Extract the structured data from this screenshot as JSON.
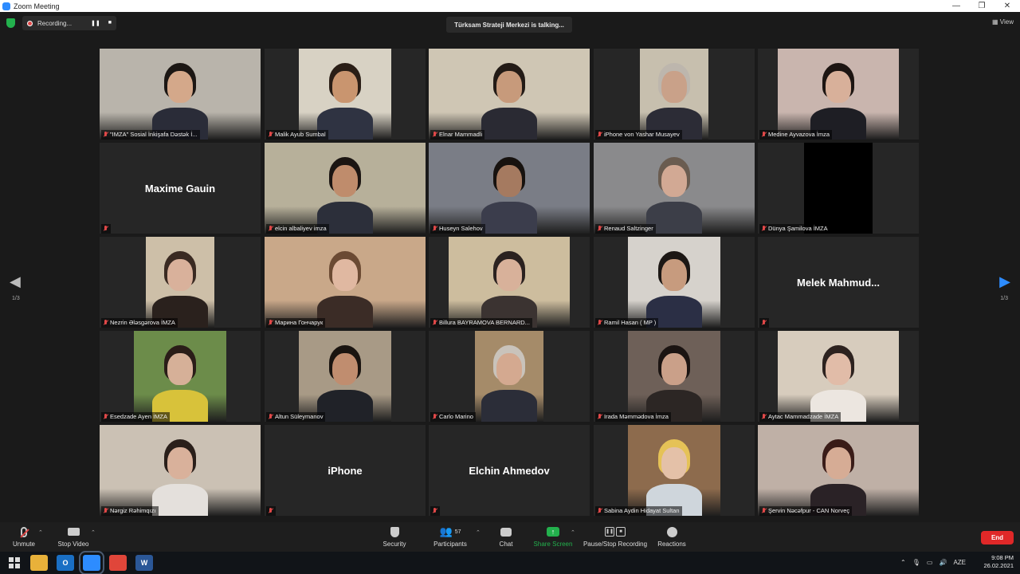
{
  "window": {
    "title": "Zoom Meeting"
  },
  "topbar": {
    "recording_label": "Recording...",
    "pause_glyph": "❚❚",
    "stop_glyph": "■",
    "talking": "Türksam Strateji Merkezi is talking...",
    "view_label": "View"
  },
  "pager": {
    "left": "1/3",
    "right": "1/3"
  },
  "participants": [
    {
      "name": "\"IMZA\" Sosial İnkişafa Dəstək İ...",
      "tile": "video",
      "bg": "#b9b4ab",
      "skin": "#d4a88a",
      "hair": "#1c1714",
      "shirt": "#2a2c38",
      "vw": 202
    },
    {
      "name": "Malik Ayub Sumbal",
      "tile": "video",
      "bg": "#d8d2c4",
      "skin": "#c9956f",
      "hair": "#2a1e16",
      "shirt": "#2f3342",
      "vw": 116
    },
    {
      "name": "Elnar Mammadli",
      "tile": "video",
      "bg": "#cfc6b4",
      "skin": "#c79a7b",
      "hair": "#231b16",
      "shirt": "#2a2a33",
      "vw": 202
    },
    {
      "name": "iPhone von Yashar Musayev",
      "tile": "video",
      "bg": "#c7bfae",
      "skin": "#c9a189",
      "hair": "#bdb6ad",
      "shirt": "#2c2c36",
      "vw": 86
    },
    {
      "name": "Medine Ayvazova İmza",
      "tile": "video",
      "bg": "#c9b5ae",
      "skin": "#d8b09a",
      "hair": "#1d1512",
      "shirt": "#1e1e24",
      "vw": 152
    },
    {
      "name": "Maxime Gauin",
      "tile": "name"
    },
    {
      "name": "elcin albaliyev imza",
      "tile": "video",
      "bg": "#b7b09a",
      "skin": "#bf8c6c",
      "hair": "#1b1512",
      "shirt": "#2c2f3a",
      "vw": 202
    },
    {
      "name": "Huseyn Salehov",
      "tile": "video",
      "bg": "#7a7d86",
      "skin": "#a57a60",
      "hair": "#17120f",
      "shirt": "#3b3d4c",
      "vw": 202
    },
    {
      "name": "Renaud Saltzinger",
      "tile": "video",
      "bg": "#8a8a8c",
      "skin": "#d2a994",
      "hair": "#6a5c50",
      "shirt": "#3c3e48",
      "vw": 202
    },
    {
      "name": "Dünya Şamilova İMZA",
      "tile": "black",
      "vw": 86
    },
    {
      "name": "Nezrin Ələsgərova İMZA",
      "tile": "video",
      "bg": "#cdbfa8",
      "skin": "#d9b19b",
      "hair": "#3a2a22",
      "shirt": "#2a211d",
      "vw": 86
    },
    {
      "name": "Марина Гончарук",
      "tile": "video",
      "bg": "#c9a889",
      "skin": "#e0b8a1",
      "hair": "#6b4a33",
      "shirt": "#3b2c26",
      "vw": 202
    },
    {
      "name": "Billura BAYRAMOVA BERNARD...",
      "tile": "video",
      "bg": "#cdbd9e",
      "skin": "#d8b19a",
      "hair": "#2b2220",
      "shirt": "#3b3331",
      "vw": 152
    },
    {
      "name": "Ramil Hasan ( MP )",
      "tile": "video",
      "bg": "#d6d2cc",
      "skin": "#c79b7e",
      "hair": "#1c1714",
      "shirt": "#2b2f45",
      "vw": 116
    },
    {
      "name": "Melek  Mahmud...",
      "tile": "name"
    },
    {
      "name": "Esedzade Ayen İMZA",
      "tile": "video",
      "bg": "#6c8c4a",
      "skin": "#d6b098",
      "hair": "#2a1d18",
      "shirt": "#d8c23a",
      "vw": 116
    },
    {
      "name": "Altun Süleymanov",
      "tile": "video",
      "bg": "#a89a86",
      "skin": "#c08d6f",
      "hair": "#1a1410",
      "shirt": "#202228",
      "vw": 116
    },
    {
      "name": "Carlo Marino",
      "tile": "video",
      "bg": "#a58b69",
      "skin": "#d4a990",
      "hair": "#c9c3bb",
      "shirt": "#2b2d38",
      "vw": 86
    },
    {
      "name": "Irada Məmmədova İmza",
      "tile": "video",
      "bg": "#6e6058",
      "skin": "#caa089",
      "hair": "#1b1412",
      "shirt": "#2c2624",
      "vw": 116
    },
    {
      "name": "Aytac Mammadzade İMZA",
      "tile": "video",
      "bg": "#d7ccbd",
      "skin": "#e1bca8",
      "hair": "#2d221f",
      "shirt": "#ece6e0",
      "vw": 152
    },
    {
      "name": "Nərgiz Rəhimqızı",
      "tile": "video",
      "bg": "#cbc1b4",
      "skin": "#d9b19b",
      "hair": "#2a1f1a",
      "shirt": "#e4e0dc",
      "vw": 202
    },
    {
      "name": "iPhone",
      "tile": "name"
    },
    {
      "name": "Elchin Ahmedov",
      "tile": "name"
    },
    {
      "name": "Sabina Aydin Hidayat Sultan",
      "tile": "video",
      "bg": "#8d6b4d",
      "skin": "#e4c1a8",
      "hair": "#e5c257",
      "shirt": "#cfd6dc",
      "vw": 116
    },
    {
      "name": "Şervin Nəcəfpur - CAN Norveç",
      "tile": "video",
      "bg": "#bfb0a6",
      "skin": "#d6ac95",
      "hair": "#3a1c18",
      "shirt": "#2a2226",
      "vw": 202
    }
  ],
  "toolbar": {
    "unmute": "Unmute",
    "stop_video": "Stop Video",
    "security": "Security",
    "participants": "Participants",
    "participants_count": "57",
    "chat": "Chat",
    "share_screen": "Share Screen",
    "recording": "Pause/Stop Recording",
    "reactions": "Reactions",
    "end": "End"
  },
  "taskbar": {
    "apps": [
      {
        "name": "file-explorer-icon",
        "color": "#e8b13a",
        "label": ""
      },
      {
        "name": "outlook-icon",
        "color": "#1a6fc4",
        "label": "O"
      },
      {
        "name": "zoom-icon",
        "color": "#2d8cff",
        "label": ""
      },
      {
        "name": "chrome-icon",
        "color": "#e0463a",
        "label": ""
      },
      {
        "name": "word-icon",
        "color": "#2b5797",
        "label": "W"
      }
    ],
    "lang": "AZE",
    "time": "9:08 PM",
    "date": "26.02.2021"
  },
  "colors": {
    "accent": "#2d8cff",
    "end": "#e02828",
    "share": "#23b14d",
    "mute": "#e04848"
  }
}
